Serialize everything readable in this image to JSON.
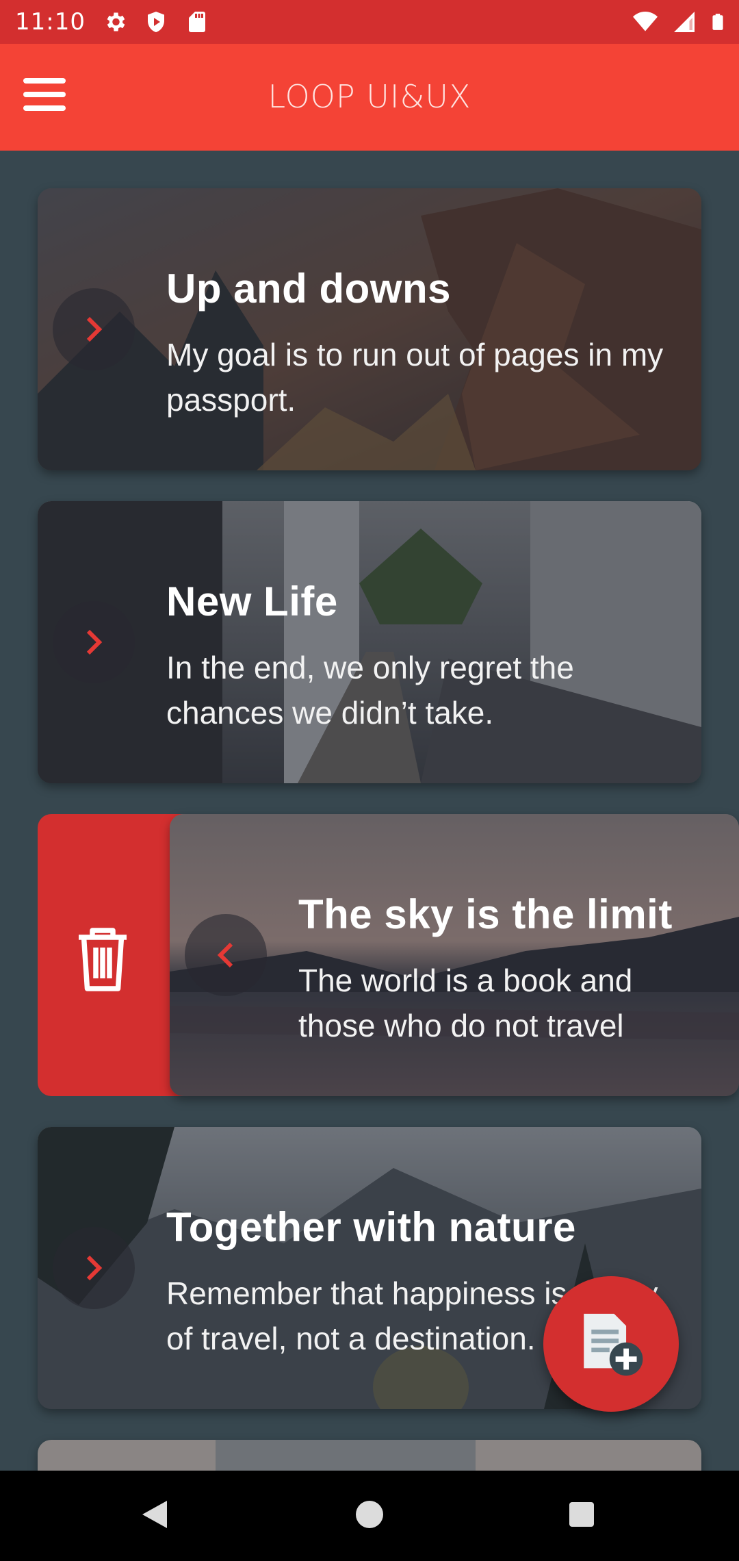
{
  "status_bar": {
    "time": "11:10",
    "left_icons": [
      "settings-icon",
      "shield-play-icon",
      "sd-card-icon"
    ],
    "right_icons": [
      "wifi-icon",
      "signal-icon",
      "battery-icon"
    ]
  },
  "app_bar": {
    "title": "LOOP UI&UX",
    "menu_icon": "hamburger-menu-icon"
  },
  "colors": {
    "status_bar": "#d32f2f",
    "app_bar": "#f44336",
    "background": "#37474f",
    "accent": "#e53935",
    "delete": "#d32f2f"
  },
  "cards": [
    {
      "title": "Up and downs",
      "text": "My goal is to run out of pages in my passport.",
      "direction": "next",
      "icon": "chevron-right-icon"
    },
    {
      "title": "New Life",
      "text": "In the end, we only regret the chances we didn’t take.",
      "direction": "next",
      "icon": "chevron-right-icon"
    },
    {
      "title": "The sky is the limit",
      "text": "The world is a book and those who do not travel",
      "direction": "back",
      "icon": "chevron-left-icon",
      "swiped": true
    },
    {
      "title": "Together with nature",
      "text": "Remember that happiness is a way of travel, not a destination.",
      "direction": "next",
      "icon": "chevron-right-icon"
    }
  ],
  "delete_action": {
    "icon": "trash-icon"
  },
  "fab": {
    "icon": "add-note-icon"
  },
  "navigation_bar": [
    "back-icon",
    "home-icon",
    "recents-icon"
  ]
}
